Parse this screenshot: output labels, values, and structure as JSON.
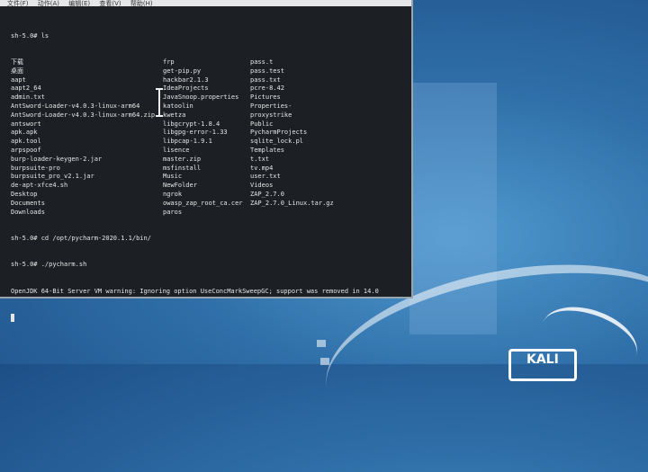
{
  "menu": [
    "文件(F)",
    "动作(A)",
    "编辑(E)",
    "查看(V)",
    "帮助(H)"
  ],
  "prompt_ls": "sh-5.0# ls",
  "listing": [
    [
      "下载",
      "frp",
      "pass.t"
    ],
    [
      "桌面",
      "get-pip.py",
      "pass.test"
    ],
    [
      "aapt",
      "hackbar2.1.3",
      "pass.txt"
    ],
    [
      "aapt2_64",
      "IdeaProjects",
      "pcre-8.42"
    ],
    [
      "admin.txt",
      "JavaSnoop.properties",
      "Pictures"
    ],
    [
      "AntSword-Loader-v4.0.3-linux-arm64",
      "katoolin",
      "Properties-"
    ],
    [
      "AntSword-Loader-v4.0.3-linux-arm64.zip",
      "kwetza",
      "proxystrike"
    ],
    [
      "antswort",
      "libgcrypt-1.8.4",
      "Public"
    ],
    [
      "apk.apk",
      "libgpg-error-1.33",
      "PycharmProjects"
    ],
    [
      "apk.tool",
      "libpcap-1.9.1",
      "sqlite_lock.pl"
    ],
    [
      "arpspoof",
      "lisence",
      "Templates"
    ],
    [
      "burp-loader-keygen-2.jar",
      "master.zip",
      "t.txt"
    ],
    [
      "burpsuite-pro",
      "msfinstall",
      "tv.mp4"
    ],
    [
      "burpsuite_pro_v2.1.jar",
      "Music",
      "user.txt"
    ],
    [
      "de-apt-xfce4.sh",
      "NewFolder",
      "Videos"
    ],
    [
      "Desktop",
      "ngrok",
      "ZAP_2.7.0"
    ],
    [
      "Documents",
      "owasp_zap_root_ca.cer",
      "ZAP_2.7.0_Linux.tar.gz"
    ],
    [
      "Downloads",
      "paros",
      ""
    ]
  ],
  "cmd_cd": "sh-5.0# cd /opt/pycharm-2020.1.1/bin/",
  "cmd_run": "sh-5.0# ./pycharm.sh",
  "warning": "OpenJDK 64-Bit Server VM warning: Ignoring option UseConcMarkSweepGC; support was removed in 14.0",
  "brand": "KALI"
}
